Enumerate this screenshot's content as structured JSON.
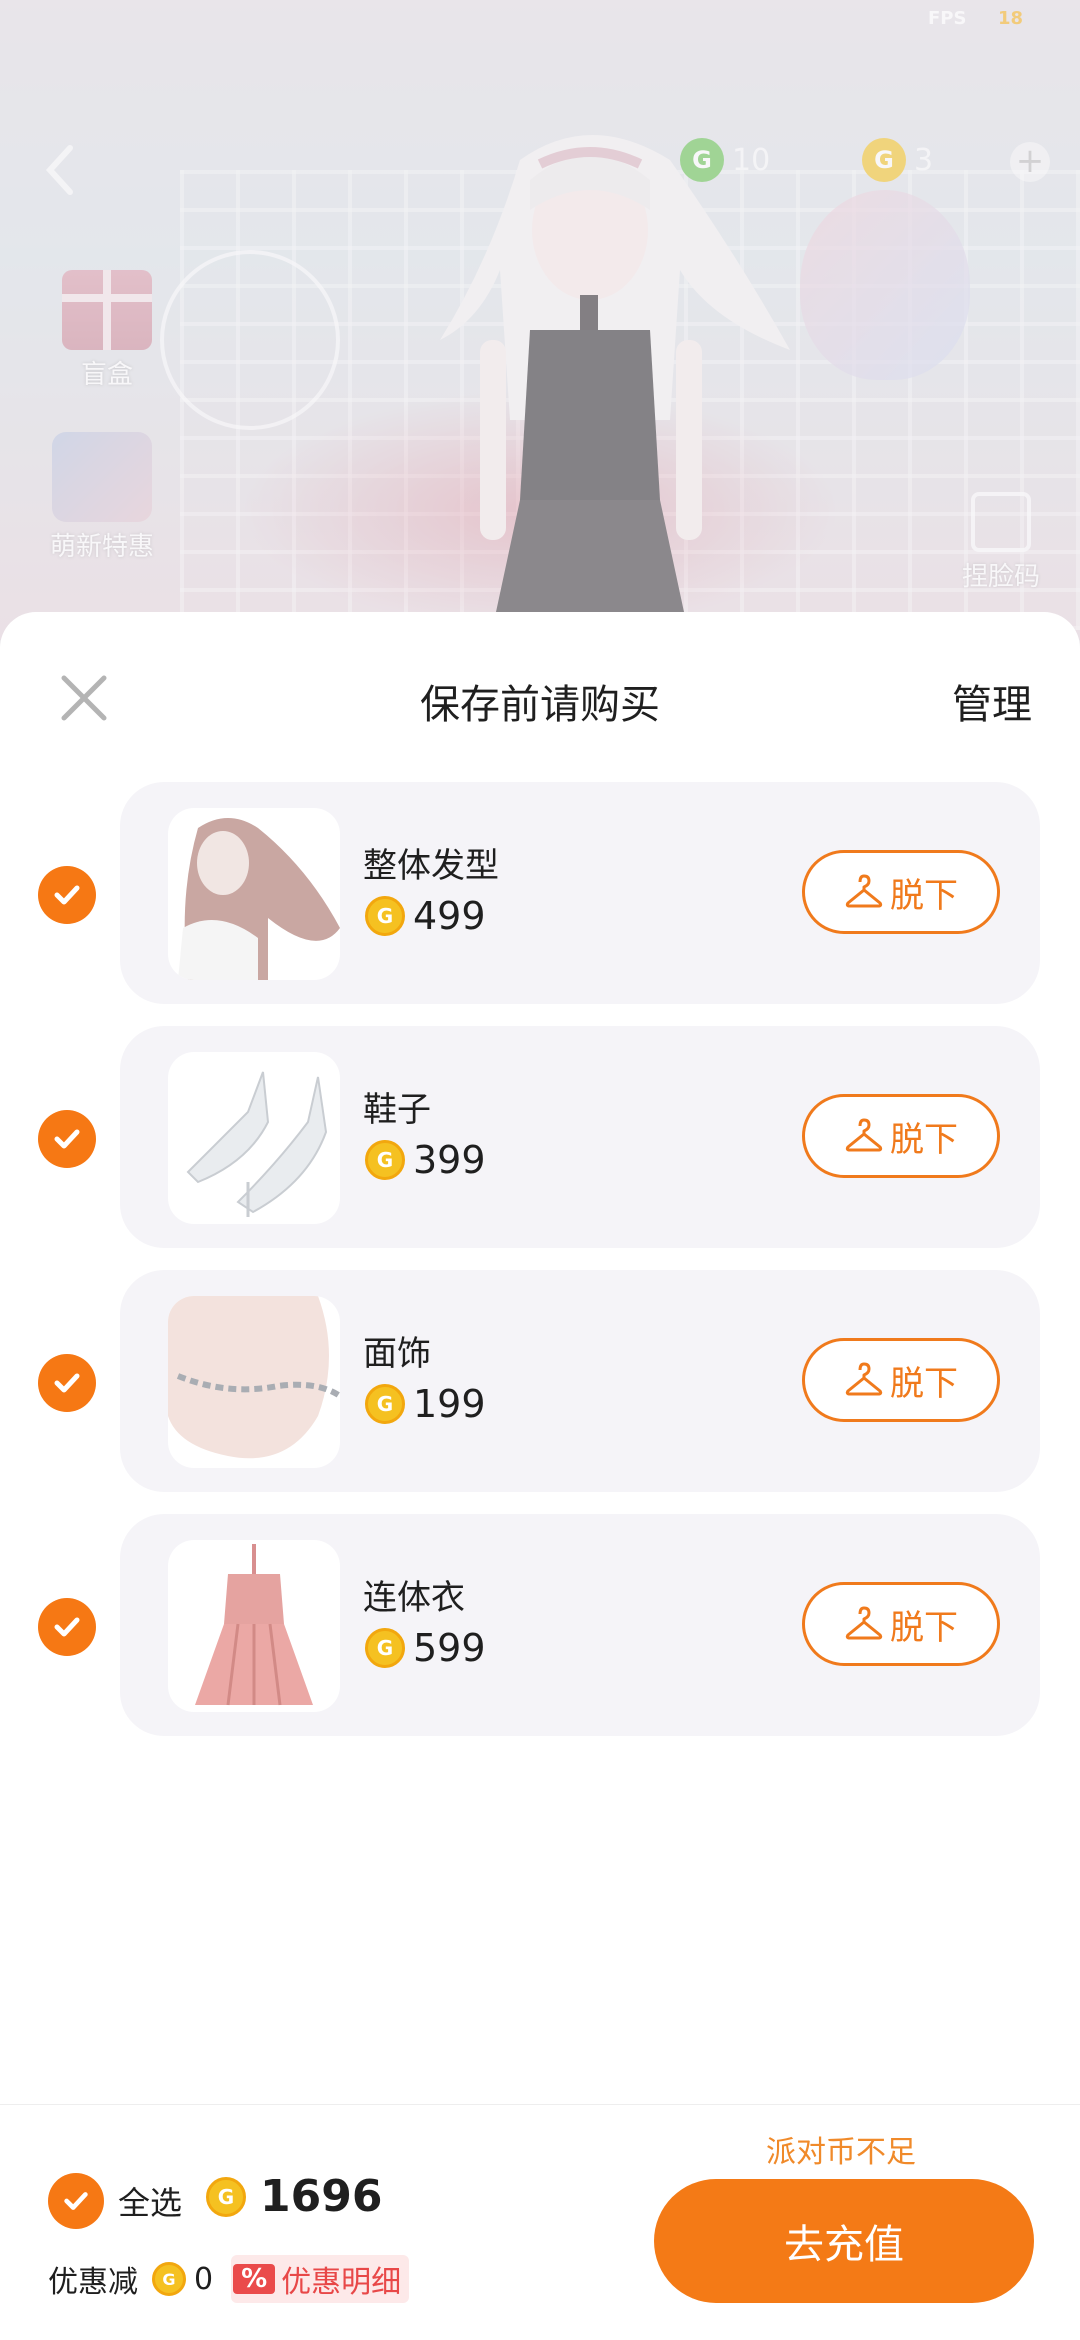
{
  "status": {
    "fps_label": "FPS",
    "fps_value": "18"
  },
  "scene": {
    "currency": [
      {
        "icon": "green-coin-icon",
        "value": "10"
      },
      {
        "icon": "gold-coin-icon",
        "value": "3"
      }
    ],
    "side_buttons": [
      {
        "label": "盲盒",
        "icon": "gift-box-icon"
      },
      {
        "label": "萌新特惠",
        "icon": "newbie-deal-icon"
      },
      {
        "label": "捏脸码",
        "icon": "face-code-icon"
      }
    ]
  },
  "sheet": {
    "title": "保存前请购买",
    "manage_label": "管理",
    "remove_label": "脱下",
    "items": [
      {
        "name": "整体发型",
        "price": "499",
        "thumb": "hair"
      },
      {
        "name": "鞋子",
        "price": "399",
        "thumb": "shoes"
      },
      {
        "name": "面饰",
        "price": "199",
        "thumb": "face"
      },
      {
        "name": "连体衣",
        "price": "599",
        "thumb": "dress"
      }
    ]
  },
  "footer": {
    "insufficient": "派对币不足",
    "select_all": "全选",
    "total": "1696",
    "discount_label": "优惠减",
    "discount_value": "0",
    "discount_pct": "%",
    "discount_detail": "优惠明细",
    "recharge": "去充值"
  },
  "colors": {
    "accent": "#f67814",
    "coin": "#f5c121",
    "discount_red": "#e84848"
  }
}
